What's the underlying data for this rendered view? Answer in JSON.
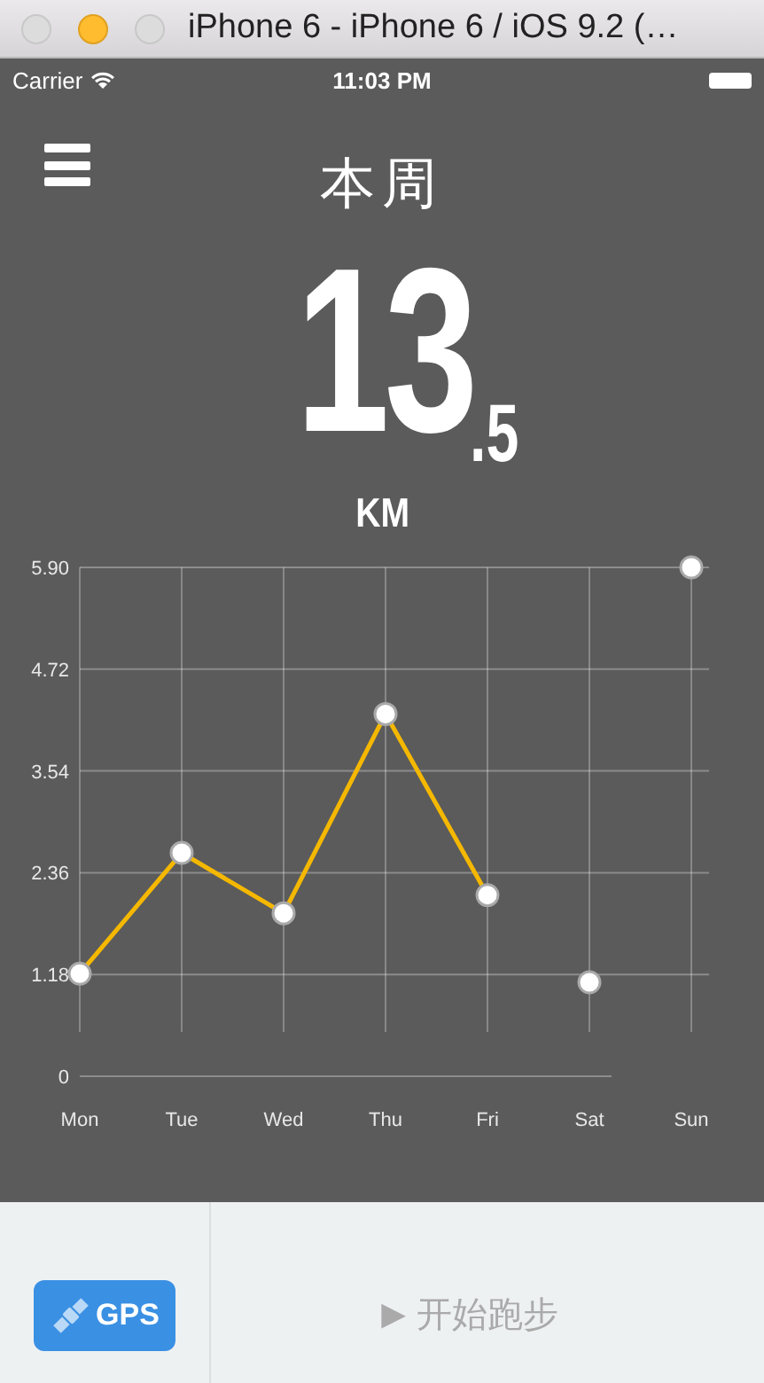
{
  "window": {
    "title": "iPhone 6 - iPhone 6 / iOS 9.2 (…"
  },
  "status_bar": {
    "carrier": "Carrier",
    "time": "11:03 PM"
  },
  "header": {
    "title": "本周"
  },
  "distance": {
    "whole": "13",
    "fraction": ".5",
    "unit": "KM"
  },
  "chart": {
    "chart_data": {
      "type": "line",
      "categories": [
        "Mon",
        "Tue",
        "Wed",
        "Thu",
        "Fri",
        "Sat",
        "Sun"
      ],
      "grid": true,
      "series": [
        {
          "color": "#f5b800",
          "marker": "circle",
          "values": [
            1.19,
            2.59,
            1.89,
            4.2,
            2.1,
            null,
            null
          ]
        },
        {
          "color": "#ffffff",
          "marker": "circle",
          "values": [
            null,
            null,
            null,
            null,
            null,
            1.09,
            null
          ]
        },
        {
          "color": "#ffffff",
          "marker": "circle",
          "values": [
            null,
            null,
            null,
            null,
            null,
            null,
            5.9
          ]
        }
      ],
      "ylim": [
        0,
        5.9
      ],
      "yticks": [
        0,
        1.18,
        2.36,
        3.54,
        4.72,
        {
          "value": 5.9,
          "label": "5.90"
        }
      ]
    }
  },
  "bottom_bar": {
    "gps_button": "GPS",
    "start_button": {
      "icon": "▶",
      "label": "开始跑步"
    }
  }
}
